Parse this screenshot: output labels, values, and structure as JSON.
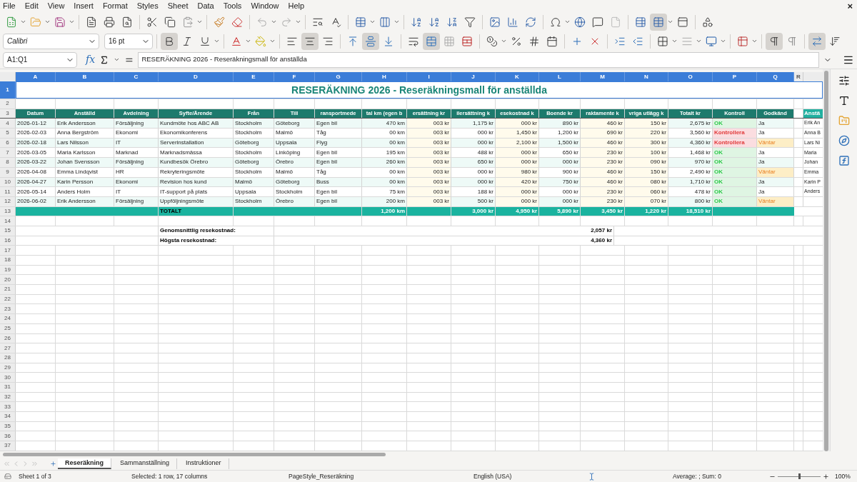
{
  "menu": [
    "File",
    "Edit",
    "View",
    "Insert",
    "Format",
    "Styles",
    "Sheet",
    "Data",
    "Tools",
    "Window",
    "Help"
  ],
  "close": "×",
  "standard_toolbar": {
    "freeze_rows_columns": true
  },
  "format_toolbar": {
    "font": "Calibri",
    "size": "16 pt",
    "bold": true,
    "italic": false,
    "underline": false,
    "alignment": {
      "left": false,
      "center": true,
      "right": false
    },
    "vertical_alignment": {
      "top": false,
      "middle": true,
      "bottom": false
    },
    "merge_center": true,
    "left_to_right": true,
    "text_direction": true
  },
  "formula_bar": {
    "name_box": "A1:Q1",
    "function_wizard": "fx",
    "content": "RESERÄKNING 2026 - Reseräkningsmall för anställda"
  },
  "columns": [
    {
      "label": "A",
      "selected": true
    },
    {
      "label": "B",
      "selected": true
    },
    {
      "label": "C",
      "selected": true
    },
    {
      "label": "D",
      "selected": true
    },
    {
      "label": "E",
      "selected": true
    },
    {
      "label": "F",
      "selected": true
    },
    {
      "label": "G",
      "selected": true
    },
    {
      "label": "H",
      "selected": true
    },
    {
      "label": "I",
      "selected": true
    },
    {
      "label": "J",
      "selected": true
    },
    {
      "label": "K",
      "selected": true
    },
    {
      "label": "L",
      "selected": true
    },
    {
      "label": "M",
      "selected": true
    },
    {
      "label": "N",
      "selected": true
    },
    {
      "label": "O",
      "selected": true
    },
    {
      "label": "P",
      "selected": true
    },
    {
      "label": "Q",
      "selected": true
    },
    {
      "label": "R",
      "selected": false
    }
  ],
  "title": "RESERÄKNING 2026 - Reseräkningsmall för anställda",
  "headers": [
    "Datum",
    "Anställd",
    "Avdelning",
    "Syfte/Ärende",
    "Från",
    "Till",
    "ransportmede",
    "tal km (egen b",
    "ersättning kr",
    "ilersättning k",
    "esekostnad k",
    "Boende kr",
    "raktamente k",
    "vriga utlägg k",
    "Totalt kr",
    "Kontroll",
    "Godkänd"
  ],
  "side_header": "Anstä",
  "rows": [
    {
      "cells": [
        "2026-01-12",
        "Erik Andersson",
        "Försäljning",
        "Kundmöte hos ABC AB",
        "Stockholm",
        "Göteborg",
        "Egen bil",
        "470 km",
        "003 kr",
        "1,175 kr",
        "000 kr",
        "890 kr",
        "460 kr",
        "150 kr",
        "2,675 kr"
      ],
      "check": {
        "text": "OK",
        "kind": "ok"
      },
      "approval": {
        "text": "Ja",
        "kind": "approved"
      },
      "side": "Erik An"
    },
    {
      "cells": [
        "2026-02-03",
        "Anna Bergström",
        "Ekonomi",
        "Ekonomikonferens",
        "Stockholm",
        "Malmö",
        "Tåg",
        "00 km",
        "003 kr",
        "000 kr",
        "1,450 kr",
        "1,200 kr",
        "690 kr",
        "220 kr",
        "3,560 kr"
      ],
      "check": {
        "text": "Kontrollera",
        "kind": "warn"
      },
      "approval": {
        "text": "Ja",
        "kind": "approved"
      },
      "side": "Anna B"
    },
    {
      "cells": [
        "2026-02-18",
        "Lars Nilsson",
        "IT",
        "Serverinstallation",
        "Göteborg",
        "Uppsala",
        "Flyg",
        "00 km",
        "003 kr",
        "000 kr",
        "2,100 kr",
        "1,500 kr",
        "460 kr",
        "300 kr",
        "4,360 kr"
      ],
      "check": {
        "text": "Kontrollera",
        "kind": "warn"
      },
      "approval": {
        "text": "Väntar",
        "kind": "pending"
      },
      "side": "Lars Ni"
    },
    {
      "cells": [
        "2026-03-05",
        "Maria Karlsson",
        "Marknad",
        "Marknadsmässa",
        "Stockholm",
        "Linköping",
        "Egen bil",
        "195 km",
        "003 kr",
        "488 kr",
        "000 kr",
        "650 kr",
        "230 kr",
        "100 kr",
        "1,468 kr"
      ],
      "check": {
        "text": "OK",
        "kind": "ok"
      },
      "approval": {
        "text": "Ja",
        "kind": "approved"
      },
      "side": "Maria"
    },
    {
      "cells": [
        "2026-03-22",
        "Johan Svensson",
        "Försäljning",
        "Kundbesök Örebro",
        "Göteborg",
        "Örebro",
        "Egen bil",
        "260 km",
        "003 kr",
        "650 kr",
        "000 kr",
        "000 kr",
        "230 kr",
        "090 kr",
        "970 kr"
      ],
      "check": {
        "text": "OK",
        "kind": "ok"
      },
      "approval": {
        "text": "Ja",
        "kind": "approved"
      },
      "side": "Johan"
    },
    {
      "cells": [
        "2026-04-08",
        "Emma Lindqvist",
        "HR",
        "Rekryteringsmöte",
        "Stockholm",
        "Malmö",
        "Tåg",
        "00 km",
        "003 kr",
        "000 kr",
        "980 kr",
        "900 kr",
        "460 kr",
        "150 kr",
        "2,490 kr"
      ],
      "check": {
        "text": "OK",
        "kind": "ok"
      },
      "approval": {
        "text": "Väntar",
        "kind": "pending"
      },
      "side": "Emma"
    },
    {
      "cells": [
        "2026-04-27",
        "Karin Persson",
        "Ekonomi",
        "Revision hos kund",
        "Malmö",
        "Göteborg",
        "Buss",
        "00 km",
        "003 kr",
        "000 kr",
        "420 kr",
        "750 kr",
        "460 kr",
        "080 kr",
        "1,710 kr"
      ],
      "check": {
        "text": "OK",
        "kind": "ok"
      },
      "approval": {
        "text": "Ja",
        "kind": "approved"
      },
      "side": "Karin P"
    },
    {
      "cells": [
        "2026-05-14",
        "Anders Holm",
        "IT",
        "IT-support på plats",
        "Uppsala",
        "Stockholm",
        "Egen bil",
        "75 km",
        "003 kr",
        "188 kr",
        "000 kr",
        "000 kr",
        "230 kr",
        "060 kr",
        "478 kr"
      ],
      "check": {
        "text": "OK",
        "kind": "ok"
      },
      "approval": {
        "text": "Ja",
        "kind": "approved"
      },
      "side": "Anders"
    },
    {
      "cells": [
        "2026-06-02",
        "Erik Andersson",
        "Försäljning",
        "Uppföljningsmöte",
        "Stockholm",
        "Örebro",
        "Egen bil",
        "200 km",
        "003 kr",
        "500 kr",
        "000 kr",
        "000 kr",
        "230 kr",
        "070 kr",
        "800 kr"
      ],
      "check": {
        "text": "OK",
        "kind": "ok"
      },
      "approval": {
        "text": "Väntar",
        "kind": "pending"
      }
    }
  ],
  "total": {
    "label": "TOTALT",
    "values": [
      "1,200 km",
      "3,000 kr",
      "4,950 kr",
      "5,890 kr",
      "3,450 kr",
      "1,220 kr",
      "18,510 kr"
    ]
  },
  "summary": [
    {
      "label": "Genomsnittlig resekostnad:",
      "value": "2,057 kr"
    },
    {
      "label": "Högsta resekostnad:",
      "value": "4,360 kr"
    }
  ],
  "row_numbers": [
    {
      "label": "1",
      "selected": true
    },
    {
      "label": "2",
      "selected": false
    },
    {
      "label": "3",
      "selected": false
    },
    {
      "label": "4",
      "selected": false
    },
    {
      "label": "5",
      "selected": false
    },
    {
      "label": "6",
      "selected": false
    },
    {
      "label": "7",
      "selected": false
    },
    {
      "label": "8",
      "selected": false
    },
    {
      "label": "9",
      "selected": false
    },
    {
      "label": "10",
      "selected": false
    },
    {
      "label": "11",
      "selected": false
    },
    {
      "label": "12",
      "selected": false
    },
    {
      "label": "13",
      "selected": false
    },
    {
      "label": "14",
      "selected": false
    },
    {
      "label": "15",
      "selected": false
    },
    {
      "label": "16",
      "selected": false
    },
    {
      "label": "17",
      "selected": false
    },
    {
      "label": "18",
      "selected": false
    },
    {
      "label": "19",
      "selected": false
    },
    {
      "label": "20",
      "selected": false
    },
    {
      "label": "21",
      "selected": false
    },
    {
      "label": "22",
      "selected": false
    },
    {
      "label": "23",
      "selected": false
    },
    {
      "label": "24",
      "selected": false
    },
    {
      "label": "25",
      "selected": false
    },
    {
      "label": "26",
      "selected": false
    },
    {
      "label": "27",
      "selected": false
    },
    {
      "label": "28",
      "selected": false
    },
    {
      "label": "29",
      "selected": false
    },
    {
      "label": "30",
      "selected": false
    },
    {
      "label": "31",
      "selected": false
    },
    {
      "label": "32",
      "selected": false
    },
    {
      "label": "33",
      "selected": false
    },
    {
      "label": "34",
      "selected": false
    },
    {
      "label": "35",
      "selected": false
    },
    {
      "label": "36",
      "selected": false
    },
    {
      "label": "37",
      "selected": false
    }
  ],
  "sheet_tabs": [
    {
      "label": "Reseräkning",
      "selected": true
    },
    {
      "label": "Sammanställning",
      "selected": false
    },
    {
      "label": "Instruktioner",
      "selected": false
    }
  ],
  "status_bar": {
    "sheet": "Sheet 1 of 3",
    "selection": "Selected: 1 row, 17 columns",
    "page_style": "PageStyle_Reseräkning",
    "language": "English (USA)",
    "summary": "Average: ; Sum: 0",
    "zoom": "100%",
    "zoom_slider": {
      "level": 0.5
    }
  }
}
